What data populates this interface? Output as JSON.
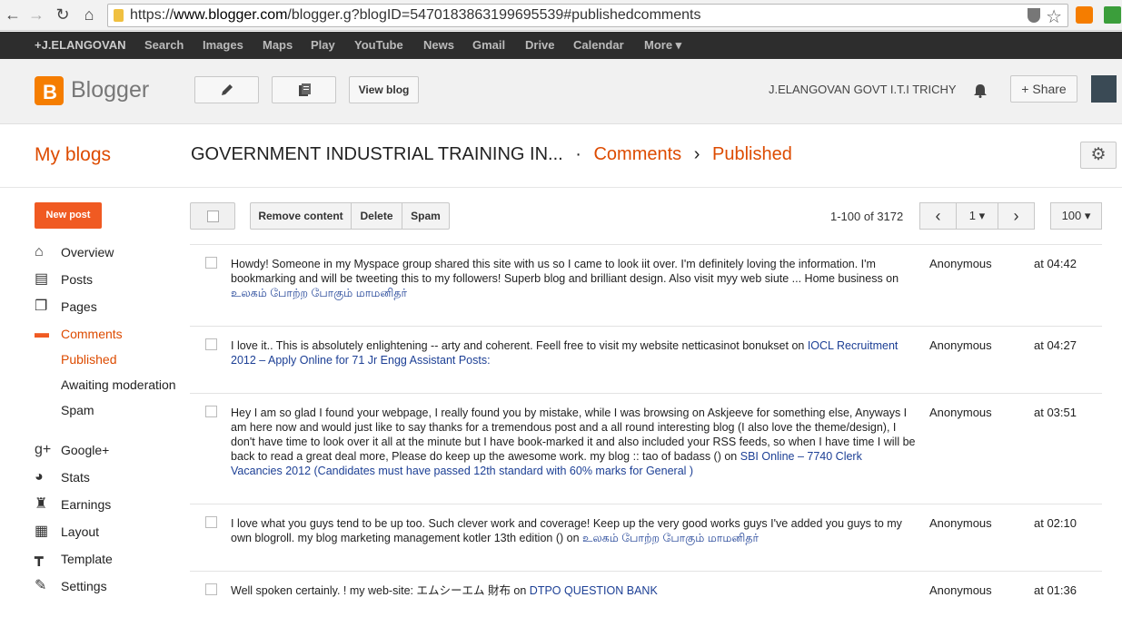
{
  "browser": {
    "url_prefix": "https://",
    "url_domain": "www.blogger.com",
    "url_rest": "/blogger.g?blogID=5470183863199695539#publishedcomments"
  },
  "gbar": {
    "user": "+J.ELANGOVAN",
    "links": [
      "Search",
      "Images",
      "Maps",
      "Play",
      "YouTube",
      "News",
      "Gmail",
      "Drive",
      "Calendar",
      "More"
    ]
  },
  "header": {
    "brand": "Blogger",
    "view_blog": "View blog",
    "account": "J.ELANGOVAN GOVT I.T.I TRICHY",
    "share": "Share"
  },
  "titlebar": {
    "my_blogs": "My blogs",
    "blog_name": "GOVERNMENT INDUSTRIAL TRAINING IN...",
    "section": "Comments",
    "subsection": "Published"
  },
  "sidebar": {
    "new_post": "New post",
    "items": [
      {
        "label": "Overview",
        "icon": "home-icon"
      },
      {
        "label": "Posts",
        "icon": "posts-icon"
      },
      {
        "label": "Pages",
        "icon": "pages-icon"
      },
      {
        "label": "Comments",
        "icon": "comments-icon"
      }
    ],
    "subitems": [
      "Published",
      "Awaiting moderation",
      "Spam"
    ],
    "items2": [
      {
        "label": "Google+",
        "icon": "google-plus-icon"
      },
      {
        "label": "Stats",
        "icon": "stats-icon"
      },
      {
        "label": "Earnings",
        "icon": "trophy-icon"
      },
      {
        "label": "Layout",
        "icon": "layout-icon"
      },
      {
        "label": "Template",
        "icon": "template-icon"
      },
      {
        "label": "Settings",
        "icon": "wrench-icon"
      }
    ]
  },
  "toolbar": {
    "remove": "Remove content",
    "delete": "Delete",
    "spam": "Spam",
    "count": "1-100 of 3172",
    "page": "1",
    "per_page": "100"
  },
  "comments": [
    {
      "text": "Howdy! Someone in my Myspace group shared this site with us so I came to look iit over. I'm definitely loving the information. I'm bookmarking and will be tweeting this to my followers! Superb blog and brilliant design. Also visit myy web siute ... Home business on ",
      "link": "உலகம் போற்ற போகும் மாமனிதர்",
      "author": "Anonymous",
      "time": "at 04:42"
    },
    {
      "text": "I love it.. This is absolutely enlightening -- arty and coherent. Feell free to visit my website netticasinot bonukset on ",
      "link": "IOCL Recruitment 2012 – Apply Online for 71 Jr Engg Assistant Posts:",
      "author": "Anonymous",
      "time": "at 04:27"
    },
    {
      "text": "Hey I am so glad I found your webpage, I really found you by mistake, while I was browsing on Askjeeve for something else, Anyways I am here now and would just like to say thanks for a tremendous post and a all round interesting blog (I also love the theme/design), I don't have time to look over it all at the minute but I have book-marked it and also included your RSS feeds, so when I have time I will be back to read a great deal more, Please do keep up the awesome work. my blog :: tao of badass () on ",
      "link": "SBI Online – 7740 Clerk Vacancies 2012 (Candidates must have passed 12th standard with 60% marks for General )",
      "author": "Anonymous",
      "time": "at 03:51"
    },
    {
      "text": "I love what you guys tend to be up too. Such clever work and coverage! Keep up the very good works guys I've added you guys to my own blogroll. my blog marketing management kotler 13th edition () on ",
      "link": "உலகம் போற்ற போகும் மாமனிதர்",
      "author": "Anonymous",
      "time": "at 02:10"
    },
    {
      "text": "Well spoken certainly. ! my web-site: エムシーエム 財布 on ",
      "link": "DTPO QUESTION BANK",
      "author": "Anonymous",
      "time": "at 01:36"
    }
  ]
}
